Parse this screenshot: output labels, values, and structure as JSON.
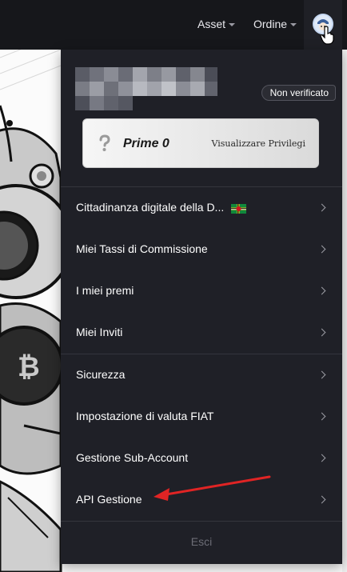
{
  "nav": {
    "asset_label": "Asset",
    "order_label": "Ordine"
  },
  "account": {
    "status_badge": "Non verificato"
  },
  "prime": {
    "title": "Prime 0",
    "link_label": "Visualizzare Privilegi"
  },
  "menu": {
    "items": [
      {
        "label": "Cittadinanza digitale della D..."
      },
      {
        "label": "Miei Tassi di Commissione"
      },
      {
        "label": "I miei premi"
      },
      {
        "label": "Miei Inviti"
      },
      {
        "label": "Sicurezza"
      },
      {
        "label": "Impostazione di valuta FIAT"
      },
      {
        "label": "Gestione Sub-Account"
      },
      {
        "label": "API Gestione"
      }
    ],
    "logout_label": "Esci"
  },
  "colors": {
    "panel_bg": "#1f2027",
    "topbar_bg": "#16171b",
    "annotation_arrow": "#e02424"
  },
  "icons": {
    "flag": "dominica-flag-icon",
    "prime": "question-mark-icon",
    "chevron": "chevron-right-icon",
    "caret": "caret-down-icon"
  }
}
